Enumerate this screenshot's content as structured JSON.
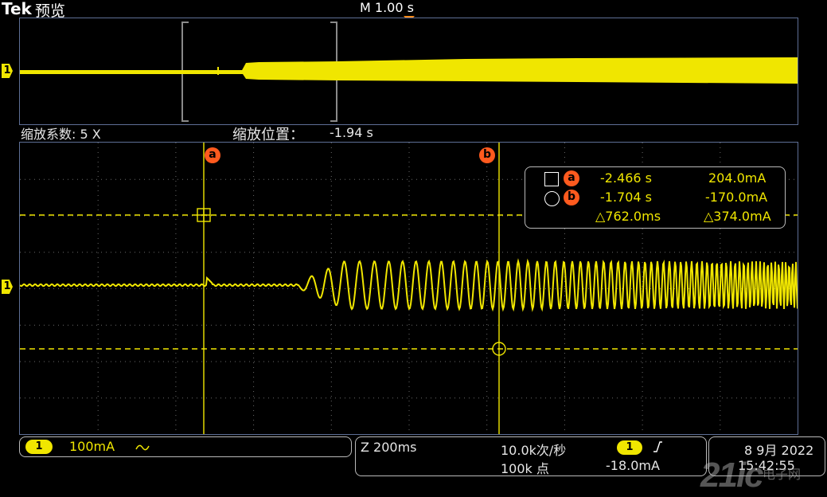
{
  "header": {
    "brand": "Tek",
    "mode": "预览",
    "timebase": "M 1.00 s"
  },
  "zoom": {
    "factor_label": "缩放系数: 5 X",
    "position_label": "缩放位置：",
    "position_value": "-1.94 s"
  },
  "channel_marker": "1",
  "cursors": {
    "a_label": "a",
    "b_label": "b",
    "readout": {
      "a_time": "-2.466 s",
      "a_value": "204.0mA",
      "b_time": "-1.704 s",
      "b_value": "-170.0mA",
      "delta_time": "△762.0ms",
      "delta_value": "△374.0mA"
    }
  },
  "status": {
    "ch_badge": "1",
    "ch_scale": "100mA",
    "ch_coupling_icon": "ac-wave-icon",
    "zoom_timebase": "Z 200ms",
    "sample_rate": "10.0k次/秒",
    "record_length": "100k 点",
    "trigger_badge": "1",
    "trigger_slope_icon": "rising-edge-icon",
    "trigger_level": "-18.0mA",
    "date": "8 9月 2022",
    "time": "15:42:55"
  },
  "watermark": {
    "text": "21ic",
    "sub": "电子网"
  },
  "colors": {
    "trace": "#f0e600",
    "cursor_badge": "#ff5a1e",
    "grid": "#5e6f96"
  }
}
